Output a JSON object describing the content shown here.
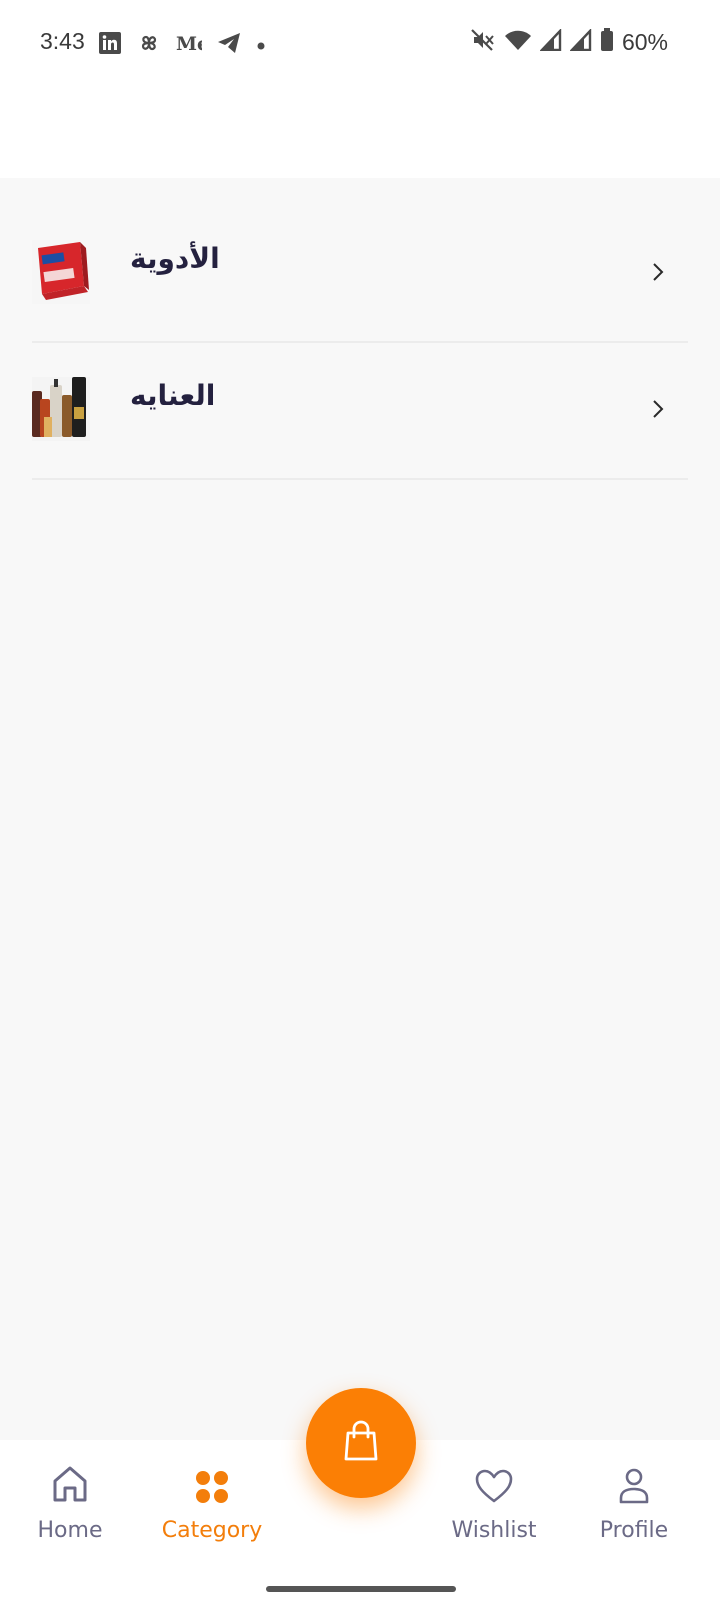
{
  "status_bar": {
    "time": "3:43",
    "battery": "60%",
    "left_icons": [
      "linkedin-icon",
      "pinwheel-icon",
      "medium-icon",
      "telegram-icon",
      "dot-icon"
    ],
    "right_icons": [
      "mute-icon",
      "wifi-icon",
      "signal-icon",
      "signal-icon",
      "battery-icon"
    ]
  },
  "categories": [
    {
      "name": "الأدوية",
      "thumb": "medicine-box-image"
    },
    {
      "name": "العنايه",
      "thumb": "care-products-image"
    }
  ],
  "bottom_nav": {
    "items": [
      {
        "label": "Home",
        "icon": "home-icon",
        "active": false
      },
      {
        "label": "Category",
        "icon": "category-grid-icon",
        "active": true
      },
      {
        "label": "Wishlist",
        "icon": "heart-icon",
        "active": false
      },
      {
        "label": "Profile",
        "icon": "user-icon",
        "active": false
      }
    ],
    "fab_icon": "shopping-bag-icon"
  },
  "colors": {
    "accent": "#fb7f05",
    "text_primary": "#24213f",
    "nav_inactive": "#6b6a86",
    "content_bg": "#f8f8f8"
  }
}
